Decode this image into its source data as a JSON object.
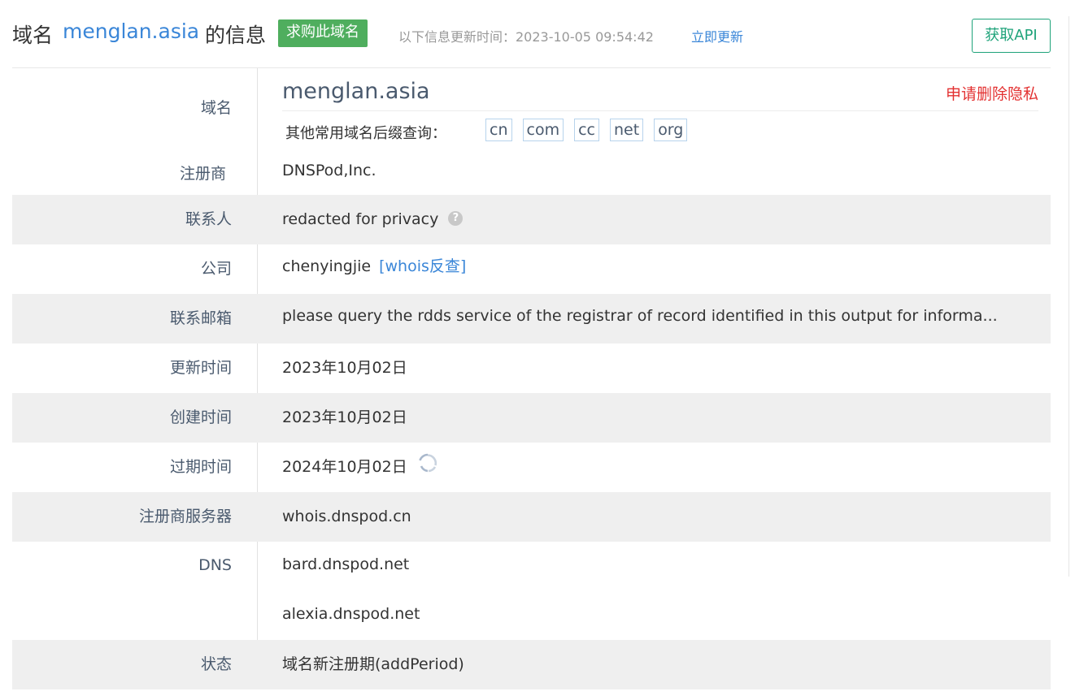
{
  "header": {
    "title_prefix": "域名",
    "domain": "menglan.asia",
    "title_suffix": "的信息",
    "buy_label": "求购此域名",
    "update_info": "以下信息更新时间：2023-10-05 09:54:42",
    "update_link": "立即更新",
    "api_button": "获取API"
  },
  "domain_section": {
    "label": "域名",
    "domain": "menglan.asia",
    "delete_privacy": "申请删除隐私",
    "suffix_label": "其他常用域名后缀查询：",
    "suffixes": [
      "cn",
      "com",
      "cc",
      "net",
      "org"
    ]
  },
  "rows": {
    "registrar": {
      "label": "注册商",
      "value": "DNSPod,Inc."
    },
    "contact": {
      "label": "联系人",
      "value": "redacted for privacy"
    },
    "company": {
      "label": "公司",
      "value": "chenyingjie",
      "link": "[whois反查]"
    },
    "email": {
      "label": "联系邮箱",
      "value": "please query the rdds service of the registrar of record identified in this output for informa..."
    },
    "updated": {
      "label": "更新时间",
      "value": "2023年10月02日"
    },
    "created": {
      "label": "创建时间",
      "value": "2023年10月02日"
    },
    "expires": {
      "label": "过期时间",
      "value": "2024年10月02日"
    },
    "registrar_server": {
      "label": "注册商服务器",
      "value": "whois.dnspod.cn"
    },
    "dns": {
      "label": "DNS",
      "values": [
        "bard.dnspod.net",
        "alexia.dnspod.net"
      ]
    },
    "status": {
      "label": "状态",
      "value": "域名新注册期(addPeriod)"
    }
  },
  "colors": {
    "accent_blue": "#3a86d8",
    "buy_green": "#4fae5e",
    "api_green": "#1fa37a",
    "delete_red": "#e33232"
  },
  "icons": [
    "help-icon",
    "refresh-icon"
  ]
}
